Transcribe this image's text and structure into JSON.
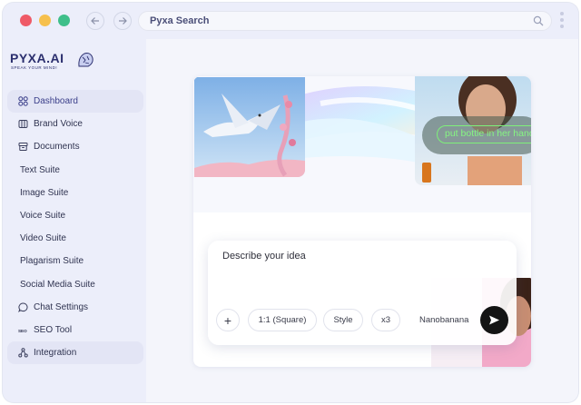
{
  "browser": {
    "address_text": "Pyxa Search",
    "icons": [
      "back-arrow-icon",
      "forward-arrow-icon",
      "search-icon",
      "more-vertical-icon"
    ],
    "traffic_light_colors": [
      "#ef5a67",
      "#f6c04d",
      "#3fbf8a"
    ]
  },
  "brand": {
    "logo_text": "PYXA.AI",
    "tagline": "SPEAK YOUR MIND!"
  },
  "sidebar": {
    "items": [
      {
        "label": "Dashboard",
        "icon": "grid-icon",
        "active": true
      },
      {
        "label": "Brand Voice",
        "icon": "book-icon"
      },
      {
        "label": "Documents",
        "icon": "archive-icon"
      },
      {
        "label": "Text Suite"
      },
      {
        "label": "Image Suite"
      },
      {
        "label": "Voice Suite"
      },
      {
        "label": "Video Suite"
      },
      {
        "label": "Plagarism Suite"
      },
      {
        "label": "Social Media Suite"
      },
      {
        "label": "Chat Settings",
        "icon": "chat-bubble-icon"
      },
      {
        "label": "SEO Tool",
        "icon": "seo-icon"
      },
      {
        "label": "Integration",
        "icon": "integration-icon",
        "highlighted": true
      }
    ]
  },
  "hero": {
    "overlay_caption": "put bottle in her hand"
  },
  "composer": {
    "placeholder": "Describe your idea",
    "add_label": "+",
    "aspect_ratio": "1:1 (Square)",
    "style_label": "Style",
    "count_label": "x3",
    "model_label": "Nanobanana"
  },
  "colors": {
    "accent": "#3b3f8a",
    "caption_green": "#86f582",
    "send_button": "#141414"
  }
}
